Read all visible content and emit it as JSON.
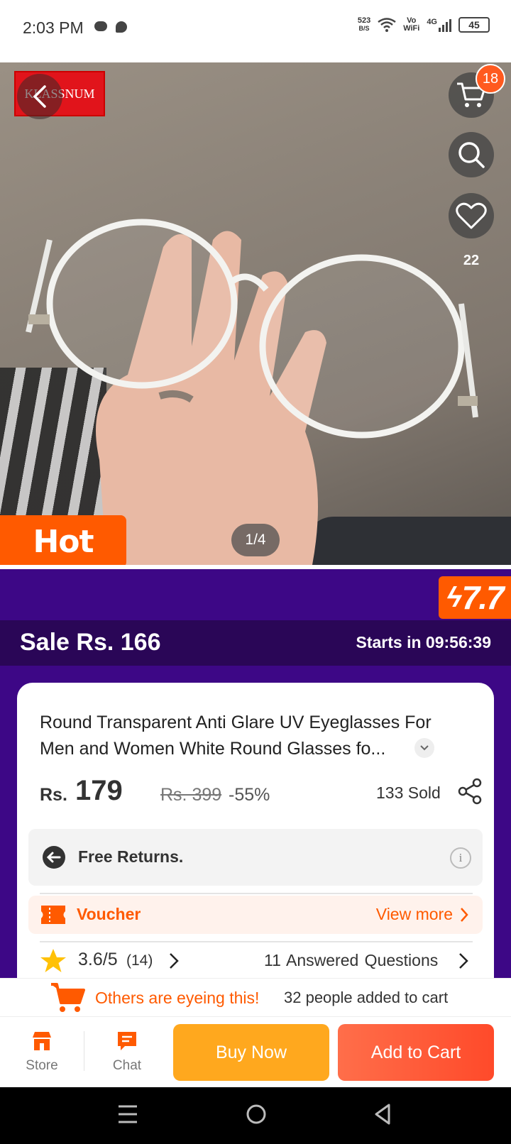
{
  "status_bar": {
    "time": "2:03 PM",
    "net_speed_value": "523",
    "net_speed_unit": "B/S",
    "vowifi_top": "Vo",
    "vowifi_bottom": "WiFi",
    "network": "4G",
    "battery": "45"
  },
  "hero": {
    "brand_logo": "KLASSNUM",
    "cart_count": "18",
    "favorites_count": "22",
    "hot_label": "Hot",
    "page_indicator": "1/4"
  },
  "promo": {
    "tag": "7.7",
    "sale_price": "Sale Rs. 166",
    "countdown": "Starts in 09:56:39"
  },
  "product": {
    "title": "Round Transparent Anti Glare UV Eyeglasses For Men and Women White Round Glasses fo...",
    "currency": "Rs.",
    "price": "179",
    "original_price": "Rs. 399",
    "discount": "-55%",
    "sold": "133 Sold",
    "returns": "Free Returns.",
    "voucher_label": "Voucher",
    "voucher_more": "View more",
    "rating": "3.6/5",
    "rating_count": "(14)",
    "qa_count": "11",
    "qa_label": "Answered Questions"
  },
  "eyeing": {
    "highlight": "Others are eyeing this!",
    "count": "32 people added to cart"
  },
  "actions": {
    "store": "Store",
    "chat": "Chat",
    "buy_now": "Buy Now",
    "add_to_cart": "Add to Cart"
  },
  "colors": {
    "accent": "#ff5a00",
    "promo_purple": "#3d0786",
    "sale_dark": "#2a0657",
    "buy_now": "#ffa81e",
    "add_to_cart": "#ff4a2a"
  }
}
